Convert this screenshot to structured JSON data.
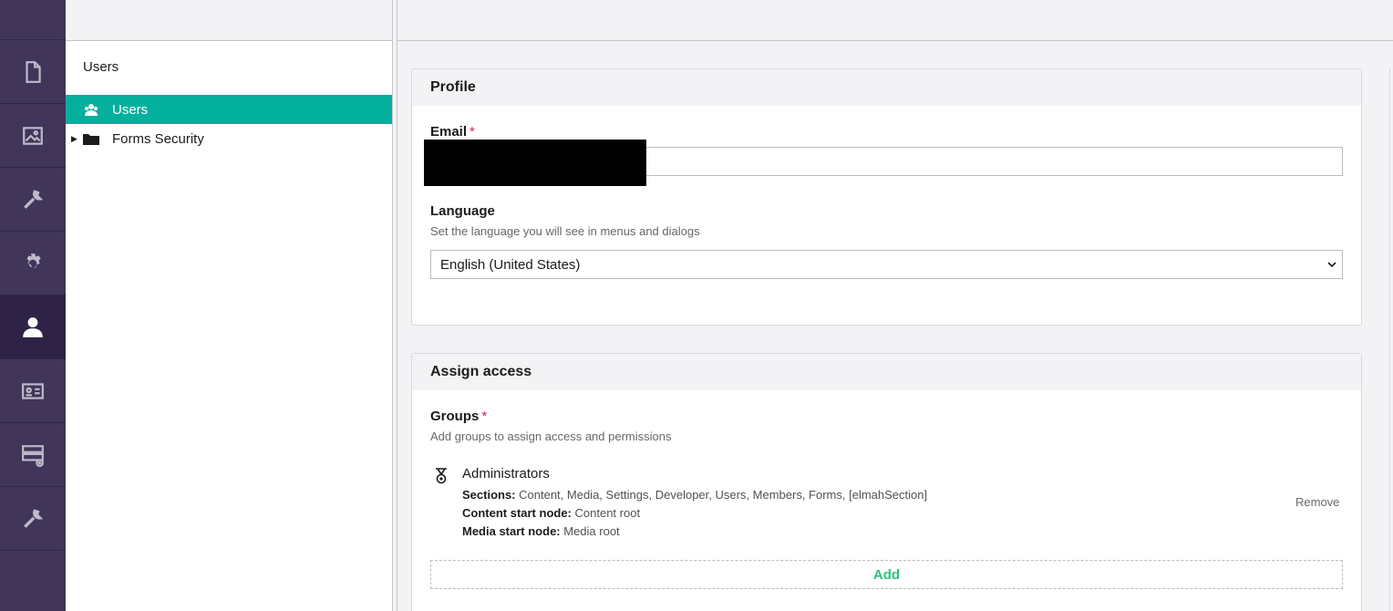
{
  "rail": {
    "items": [
      {
        "icon": "content-icon"
      },
      {
        "icon": "media-icon"
      },
      {
        "icon": "settings-wrench-icon"
      },
      {
        "icon": "gear-icon"
      },
      {
        "icon": "user-icon",
        "active": true
      },
      {
        "icon": "member-card-icon"
      },
      {
        "icon": "forms-icon"
      },
      {
        "icon": "developer-wrench-icon"
      }
    ]
  },
  "tree": {
    "title": "Users",
    "nodes": [
      {
        "label": "Users",
        "icon": "users-icon",
        "selected": true
      },
      {
        "label": "Forms Security",
        "icon": "folder-icon",
        "expandable": true
      }
    ]
  },
  "profile": {
    "header": "Profile",
    "email_label": "Email",
    "email_required": "*",
    "language_label": "Language",
    "language_desc": "Set the language you will see in menus and dialogs",
    "language_value": "English (United States)"
  },
  "access": {
    "header": "Assign access",
    "groups_label": "Groups",
    "groups_required": "*",
    "groups_desc": "Add groups to assign access and permissions",
    "group": {
      "name": "Administrators",
      "sections_label": "Sections:",
      "sections_value": "Content, Media, Settings, Developer, Users, Members, Forms, [elmahSection]",
      "content_start_label": "Content start node:",
      "content_start_value": "Content root",
      "media_start_label": "Media start node:",
      "media_start_value": "Media root",
      "remove_label": "Remove"
    },
    "add_label": "Add"
  },
  "colors": {
    "rail_bg": "#413659",
    "selected_node": "#03b09d",
    "add_text": "#2bc37c",
    "required": "#d42054"
  }
}
